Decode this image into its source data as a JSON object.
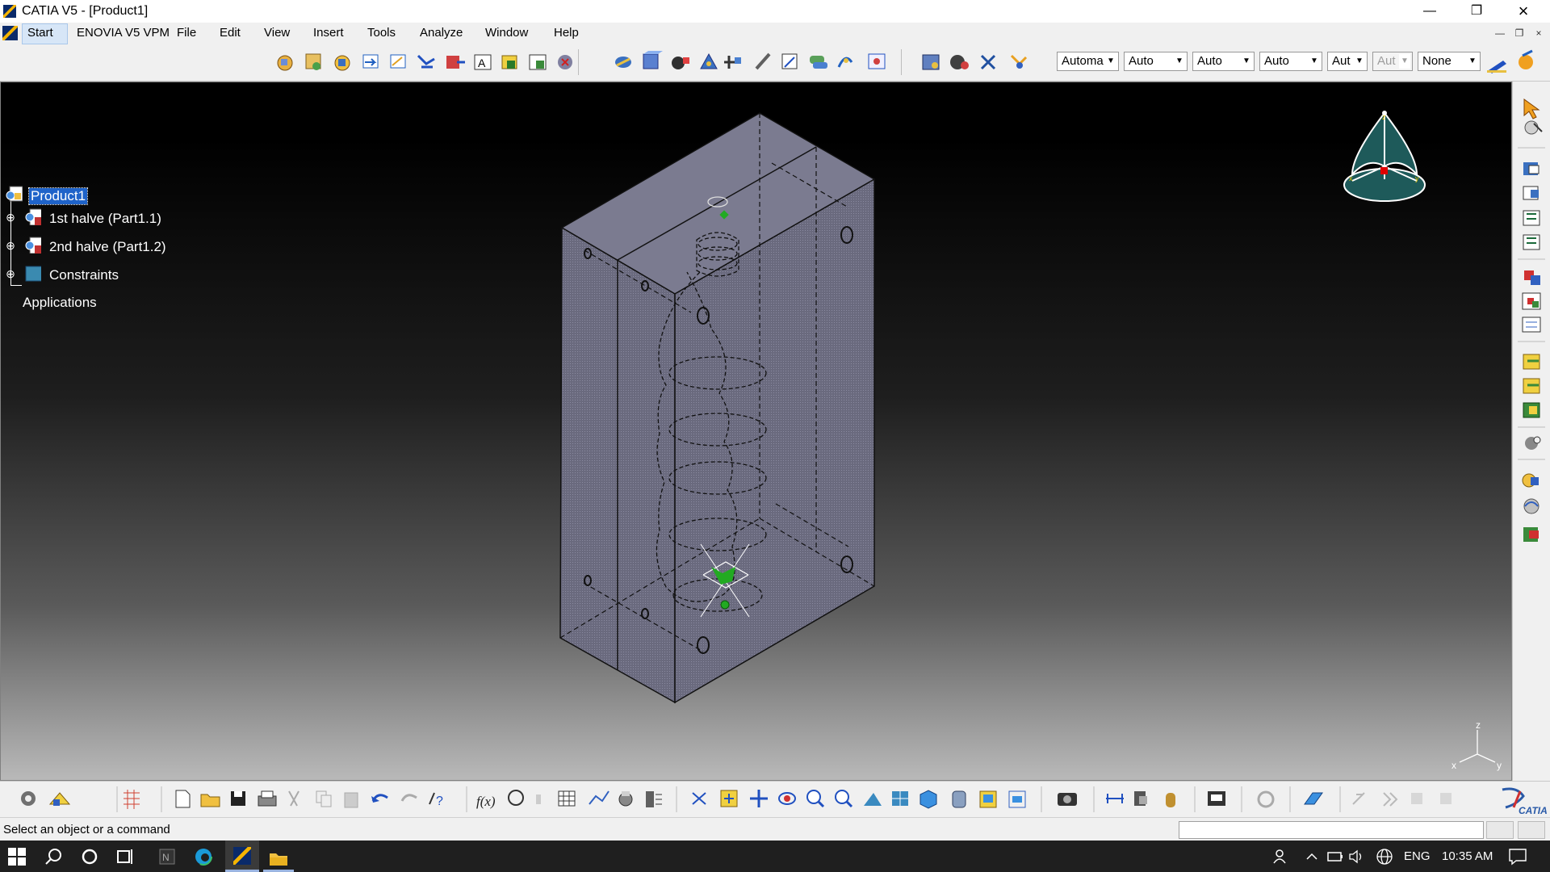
{
  "window": {
    "title": "CATIA V5 - [Product1]",
    "controls": [
      "minimize",
      "restore",
      "close"
    ]
  },
  "menubar": {
    "items": [
      {
        "label": "Start"
      },
      {
        "label": "ENOVIA V5 VPM"
      },
      {
        "label": "File"
      },
      {
        "label": "Edit"
      },
      {
        "label": "View"
      },
      {
        "label": "Insert"
      },
      {
        "label": "Tools"
      },
      {
        "label": "Analyze"
      },
      {
        "label": "Window"
      },
      {
        "label": "Help"
      }
    ]
  },
  "toolbar_top": {
    "combos": [
      {
        "value": "Automa",
        "enabled": true
      },
      {
        "value": "Auto",
        "enabled": true
      },
      {
        "value": "Auto",
        "enabled": true
      },
      {
        "value": "Auto",
        "enabled": true
      },
      {
        "value": "Aut",
        "enabled": true
      },
      {
        "value": "Aut",
        "enabled": false
      },
      {
        "value": "None",
        "enabled": true
      }
    ]
  },
  "tree": {
    "root": "Product1",
    "children": [
      {
        "label": "1st halve (Part1.1)",
        "icon": "part-icon"
      },
      {
        "label": "2nd halve (Part1.2)",
        "icon": "part-icon"
      },
      {
        "label": "Constraints",
        "icon": "constraints-icon"
      }
    ],
    "applications": "Applications"
  },
  "compass_axes": [
    "z",
    "x",
    "y"
  ],
  "axis_triad": [
    "z",
    "x",
    "y"
  ],
  "brand": "CATIA",
  "statusbar": {
    "message": "Select an object or a command"
  },
  "taskbar": {
    "language": "ENG",
    "time": "10:35 AM"
  },
  "colors": {
    "selection": "#1f63c9",
    "mold_fill": "#6e6e82",
    "compass": "#1e5a5a",
    "anchor_green": "#22aa22"
  }
}
